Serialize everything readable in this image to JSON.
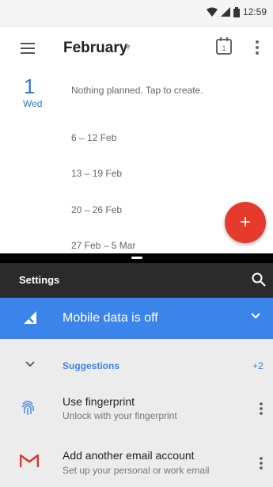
{
  "status_bar": {
    "time": "12:59"
  },
  "calendar": {
    "month": "February",
    "day_number": "1",
    "day_name": "Wed",
    "empty_message": "Nothing planned. Tap to create.",
    "weeks": [
      "6 – 12 Feb",
      "13 – 19 Feb",
      "20 – 26 Feb",
      "27 Feb – 5 Mar"
    ],
    "fab_label": "+",
    "accent_color": "#2e78c7",
    "fab_color": "#e53a2c"
  },
  "settings": {
    "title": "Settings",
    "banner_text": "Mobile data is off",
    "banner_color": "#3b84ea",
    "suggestions_label": "Suggestions",
    "suggestions_count": "+2",
    "suggestions": [
      {
        "title": "Use fingerprint",
        "subtitle": "Unlock with your fingerprint",
        "icon": "fingerprint-icon"
      },
      {
        "title": "Add another email account",
        "subtitle": "Set up your personal or work email",
        "icon": "gmail-icon"
      }
    ]
  }
}
